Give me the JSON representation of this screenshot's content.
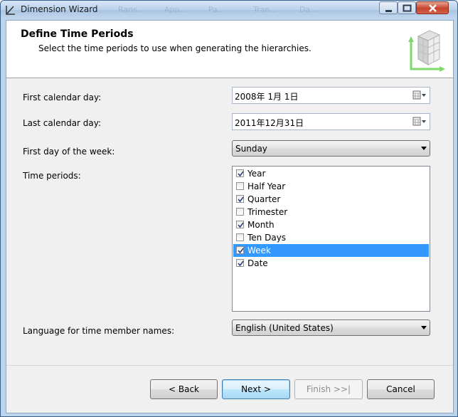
{
  "window": {
    "title": "Dimension Wizard",
    "background_tabs": [
      "Rans...",
      "App...",
      "Pa...",
      "Tran...",
      "Da..."
    ]
  },
  "header": {
    "title": "Define Time Periods",
    "subtitle": "Select the time periods to use when generating the hierarchies."
  },
  "form": {
    "first_day_label": "First calendar day:",
    "first_day_value": "2008年  1月  1日",
    "last_day_label": "Last calendar day:",
    "last_day_value": "2011年12月31日",
    "week_start_label": "First day of the week:",
    "week_start_value": "Sunday",
    "periods_label": "Time periods:",
    "periods": [
      {
        "label": "Year",
        "checked": true
      },
      {
        "label": "Half Year",
        "checked": false
      },
      {
        "label": "Quarter",
        "checked": true
      },
      {
        "label": "Trimester",
        "checked": false
      },
      {
        "label": "Month",
        "checked": true
      },
      {
        "label": "Ten Days",
        "checked": false
      },
      {
        "label": "Week",
        "checked": true,
        "selected": true
      },
      {
        "label": "Date",
        "checked": true
      }
    ],
    "language_label": "Language for time member names:",
    "language_value": "English (United States)"
  },
  "buttons": {
    "back": "< Back",
    "next": "Next >",
    "finish": "Finish >>|",
    "cancel": "Cancel"
  },
  "colors": {
    "selection": "#3399ff",
    "titlebar": "#b9d1ea",
    "close_button": "#c7432c"
  }
}
